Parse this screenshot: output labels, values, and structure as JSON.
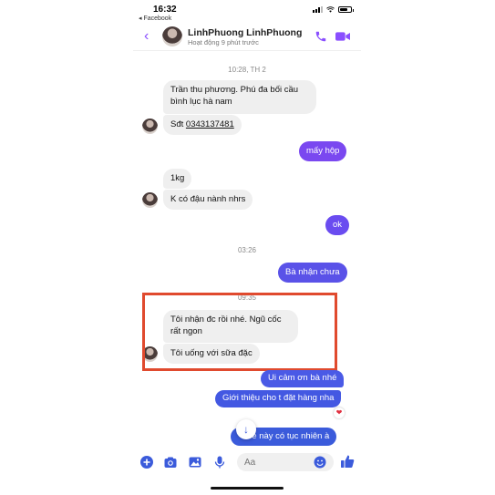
{
  "status_bar": {
    "time": "16:32",
    "back_app": "◂ Facebook"
  },
  "header": {
    "contact_name": "LinhPhuong LinhPhuong",
    "contact_status": "Hoạt động 9 phút trước"
  },
  "messages": {
    "ts1": "10:28, TH 2",
    "m1": "Trần thu phương. Phú đa bối cầu",
    "m1b": "bình lục hà nam",
    "m2_prefix": "Sđt ",
    "m2_phone": "0343137481",
    "m3": "mấy hộp",
    "m4": "1kg",
    "m5": "K có đậu nành nhrs",
    "m6": "ok",
    "ts2": "03:26",
    "m7": "Bà nhận chưa",
    "ts3": "09:35",
    "m8": "Tôi nhận đc rồi nhé. Ngũ cốc",
    "m8b": "rất ngon",
    "m9": "Tôi uống với sữa đặc",
    "m10": "Ui cảm ơn bà nhé",
    "m11": "Giới thiệu cho t đặt hàng nha",
    "m12": "bé này có tục nhiên à"
  },
  "composer": {
    "placeholder": "Aa"
  },
  "colors": {
    "accent": "#8a4fff",
    "bubble_out_top": "#8a3fe6",
    "bubble_out_bottom": "#3b5bdb",
    "highlight": "#e04a2e"
  }
}
